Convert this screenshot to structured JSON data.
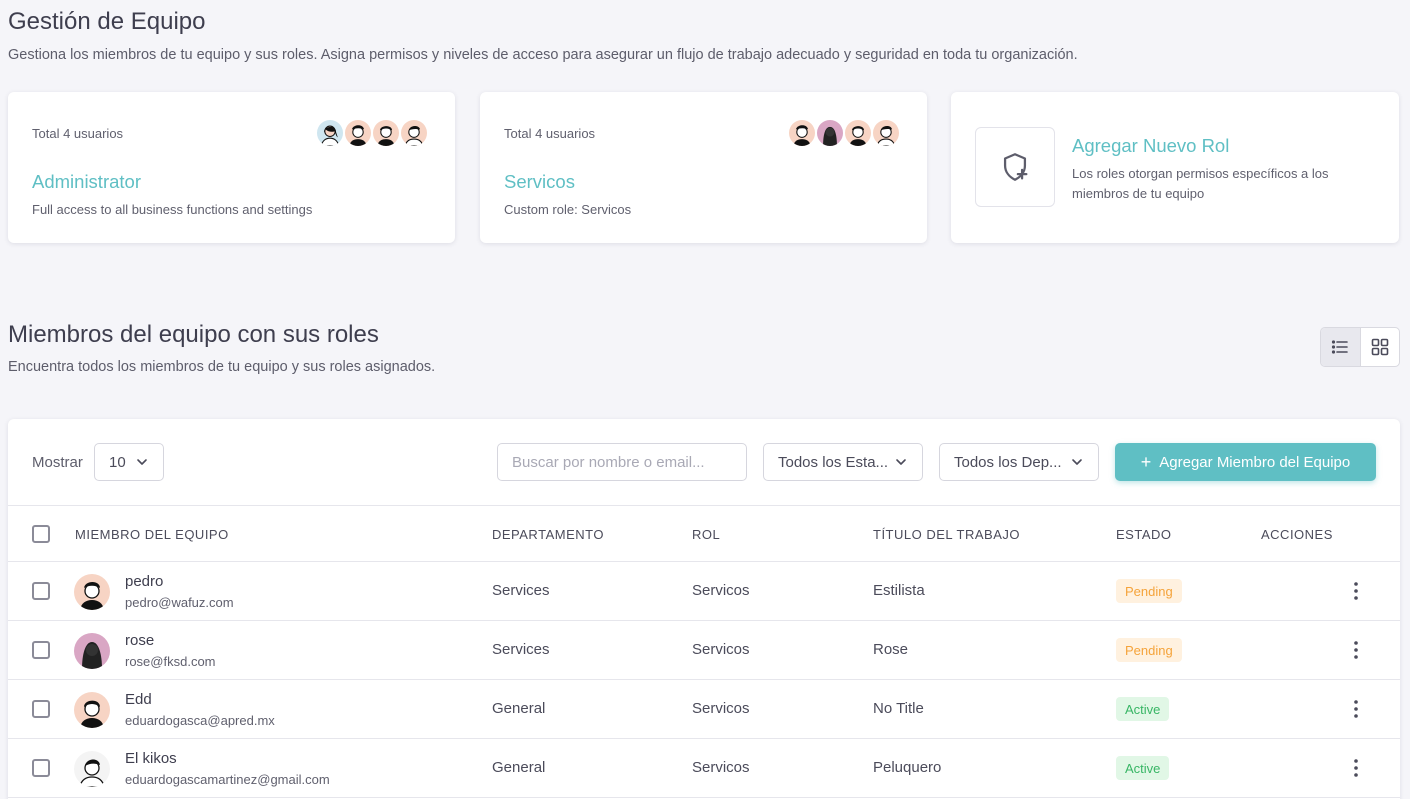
{
  "header": {
    "title": "Gestión de Equipo",
    "subtitle": "Gestiona los miembros de tu equipo y sus roles. Asigna permisos y niveles de acceso para asegurar un flujo de trabajo adecuado y seguridad en toda tu organización."
  },
  "role_cards": [
    {
      "total": "Total 4 usuarios",
      "name": "Administrator",
      "description": "Full access to all business functions and settings"
    },
    {
      "total": "Total 4 usuarios",
      "name": "Servicos",
      "description": "Custom role: Servicos"
    }
  ],
  "add_role": {
    "title": "Agregar Nuevo Rol",
    "description": "Los roles otorgan permisos específicos a los miembros de tu equipo"
  },
  "members_section": {
    "title": "Miembros del equipo con sus roles",
    "subtitle": "Encuentra todos los miembros de tu equipo y sus roles asignados."
  },
  "toolbar": {
    "show_label": "Mostrar",
    "show_value": "10",
    "search_placeholder": "Buscar por nombre o email...",
    "status_filter": "Todos los Esta...",
    "department_filter": "Todos los Dep...",
    "add_member_label": "Agregar Miembro del Equipo"
  },
  "table": {
    "columns": [
      "MIEMBRO DEL EQUIPO",
      "DEPARTAMENTO",
      "ROL",
      "TÍTULO DEL TRABAJO",
      "ESTADO",
      "ACCIONES"
    ],
    "rows": [
      {
        "name": "pedro",
        "email": "pedro@wafuz.com",
        "department": "Services",
        "role": "Servicos",
        "job_title": "Estilista",
        "status": "Pending"
      },
      {
        "name": "rose",
        "email": "rose@fksd.com",
        "department": "Services",
        "role": "Servicos",
        "job_title": "Rose",
        "status": "Pending"
      },
      {
        "name": "Edd",
        "email": "eduardogasca@apred.mx",
        "department": "General",
        "role": "Servicos",
        "job_title": "No Title",
        "status": "Active"
      },
      {
        "name": "El kikos",
        "email": "eduardogascamartinez@gmail.com",
        "department": "General",
        "role": "Servicos",
        "job_title": "Peluquero",
        "status": "Active"
      }
    ]
  },
  "colors": {
    "accent": "#5fbfc4",
    "pending_bg": "#fff1df",
    "pending_text": "#f5a33a",
    "active_bg": "#e1f7e6",
    "active_text": "#38b665"
  },
  "icons": {
    "view_list": "list-icon",
    "view_grid": "grid-icon",
    "add_role": "shield-plus-icon",
    "dropdown": "chevron-down-icon",
    "row_actions": "kebab-menu-icon"
  }
}
